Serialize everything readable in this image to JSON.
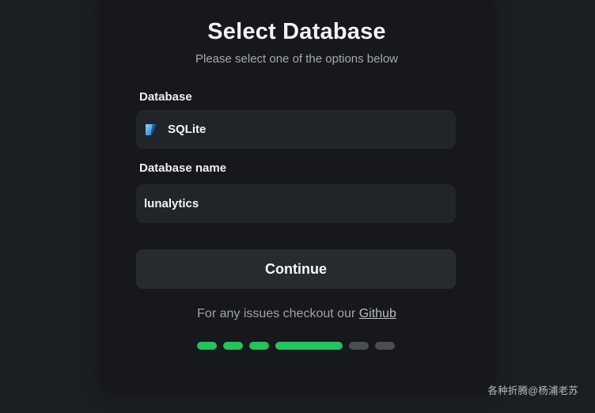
{
  "header": {
    "title": "Select Database",
    "subtitle": "Please select one of the options below"
  },
  "form": {
    "database_label": "Database",
    "database_value": "SQLite",
    "database_icon": "sqlite-icon",
    "database_name_label": "Database name",
    "database_name_value": "lunalytics",
    "continue_label": "Continue"
  },
  "help": {
    "text": "For any issues checkout our ",
    "link": "Github"
  },
  "progress": {
    "steps": [
      "done",
      "done",
      "done",
      "current",
      "pending",
      "pending"
    ],
    "active_color": "#21c45d",
    "inactive_color": "#4a4e54"
  },
  "watermark": "各种折腾@杨浦老苏"
}
